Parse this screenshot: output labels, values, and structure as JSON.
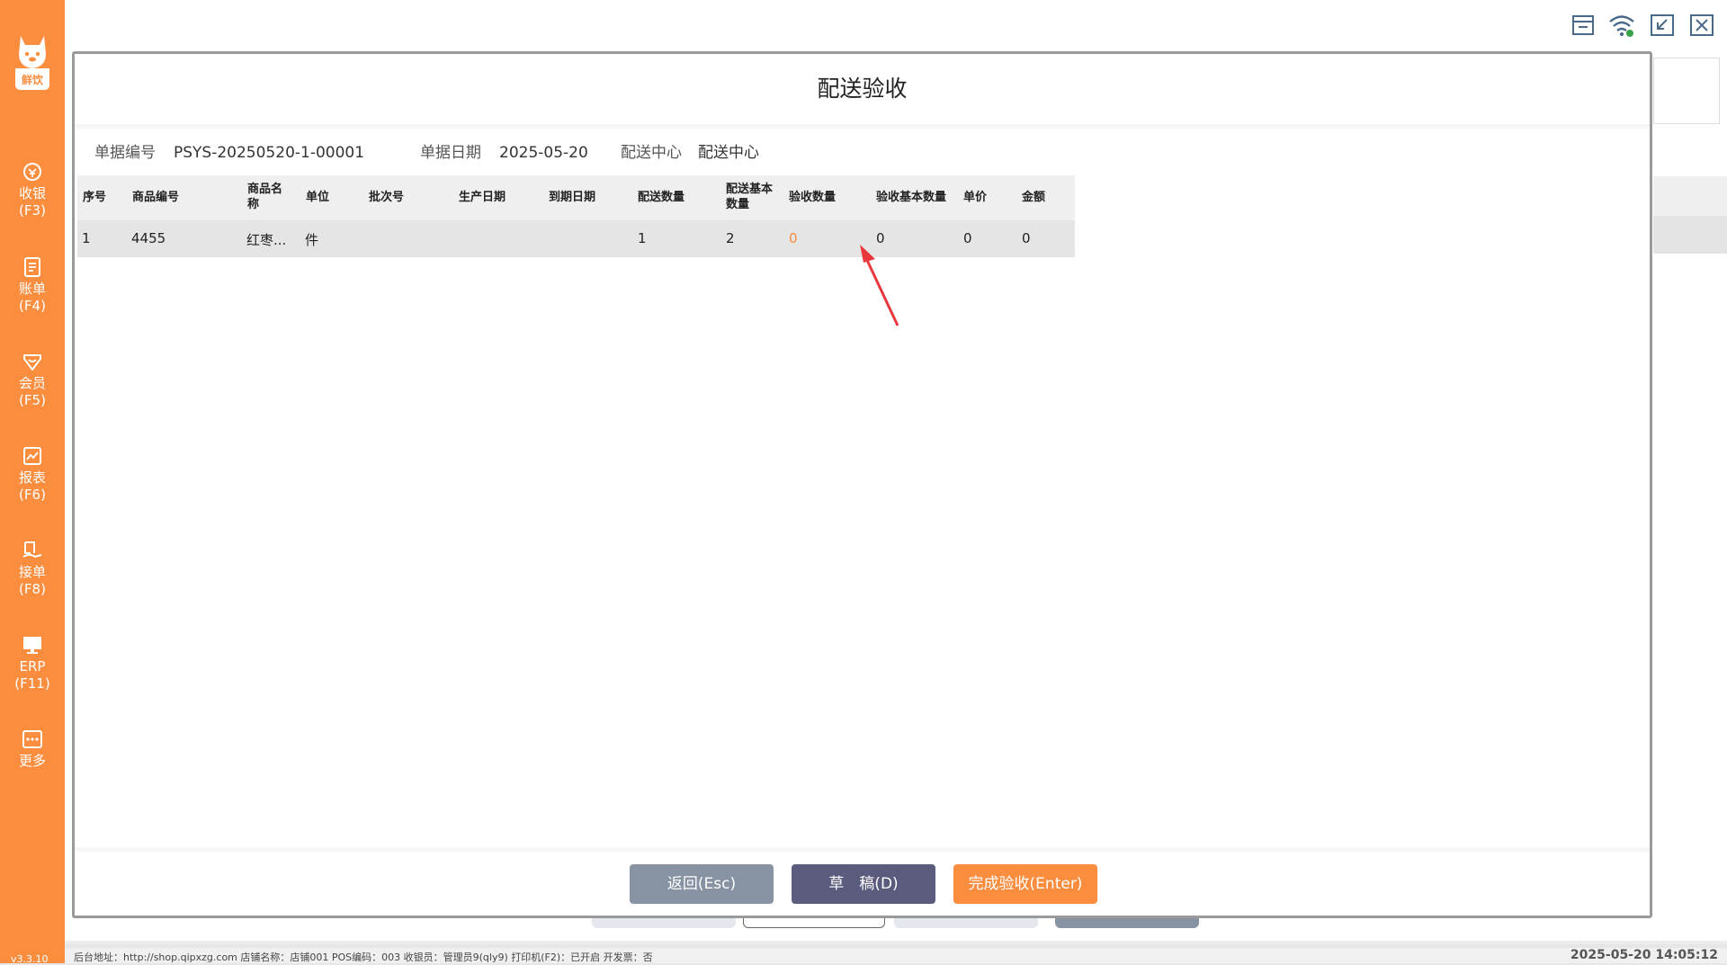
{
  "app": {
    "brand_text": "鲜饮",
    "version": "v3.3.10"
  },
  "sidebar": {
    "items": [
      {
        "label": "收银",
        "key": "(F3)"
      },
      {
        "label": "账单",
        "key": "(F4)"
      },
      {
        "label": "会员",
        "key": "(F5)"
      },
      {
        "label": "报表",
        "key": "(F6)"
      },
      {
        "label": "接单",
        "key": "(F8)"
      },
      {
        "label": "ERP",
        "key": "(F11)"
      },
      {
        "label": "更多",
        "key": ""
      }
    ]
  },
  "topbar": {
    "icons": [
      "store-icon",
      "wifi-icon",
      "minimize-icon",
      "close-icon"
    ]
  },
  "modal": {
    "title": "配送验收",
    "meta": {
      "doc_no_label": "单据编号",
      "doc_no": "PSYS-20250520-1-00001",
      "doc_date_label": "单据日期",
      "doc_date": "2025-05-20",
      "center_label": "配送中心",
      "center": "配送中心"
    },
    "table": {
      "headers": {
        "seq": "序号",
        "code": "商品编号",
        "name": "商品名称",
        "unit": "单位",
        "batch": "批次号",
        "mfg": "生产日期",
        "exp": "到期日期",
        "ship_qty": "配送数量",
        "ship_base_qty": "配送基本数量",
        "recv_qty": "验收数量",
        "recv_base_qty": "验收基本数量",
        "price": "单价",
        "amount": "金额"
      },
      "rows": [
        {
          "seq": "1",
          "code": "4455",
          "name": "红枣...",
          "unit": "件",
          "batch": "",
          "mfg": "",
          "exp": "",
          "ship_qty": "1",
          "ship_base_qty": "2",
          "recv_qty": "0",
          "recv_base_qty": "0",
          "price": "0",
          "amount": "0"
        }
      ]
    },
    "buttons": {
      "back": "返回(Esc)",
      "draft": "草　稿(D)",
      "confirm": "完成验收(Enter)"
    }
  },
  "statusbar": {
    "left": "后台地址：http://shop.qipxzg.com  店铺名称：店铺001  POS编码：003  收银员：管理员9(qly9)  打印机(F2)：已开启  开发票：否",
    "datetime": "2025-05-20 14:05:12"
  },
  "colors": {
    "accent": "#fb8d3f",
    "btn_back": "#8792a2",
    "btn_draft": "#5b5b7e",
    "btn_confirm": "#fb8d3f",
    "recv_qty": "#fb8d3f",
    "arrow": "#e8383d"
  }
}
